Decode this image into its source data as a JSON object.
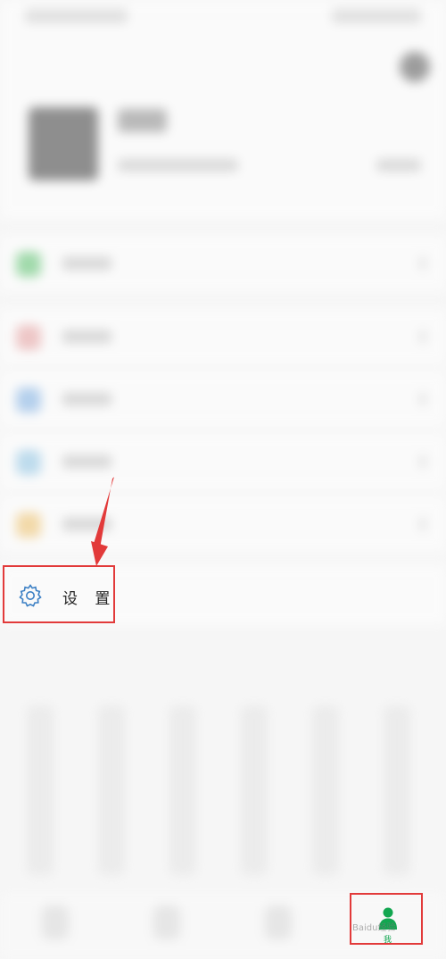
{
  "settings": {
    "label": "设 置",
    "icon": "gear-icon"
  },
  "tabbar": {
    "active_tab_icon": "person-icon",
    "active_tab_label": "我",
    "active_color": "#12a650"
  },
  "annotation": {
    "arrow_color": "#e23a3a",
    "box_color": "#e23a3a"
  },
  "watermark": {
    "text": "Baidu经验"
  }
}
